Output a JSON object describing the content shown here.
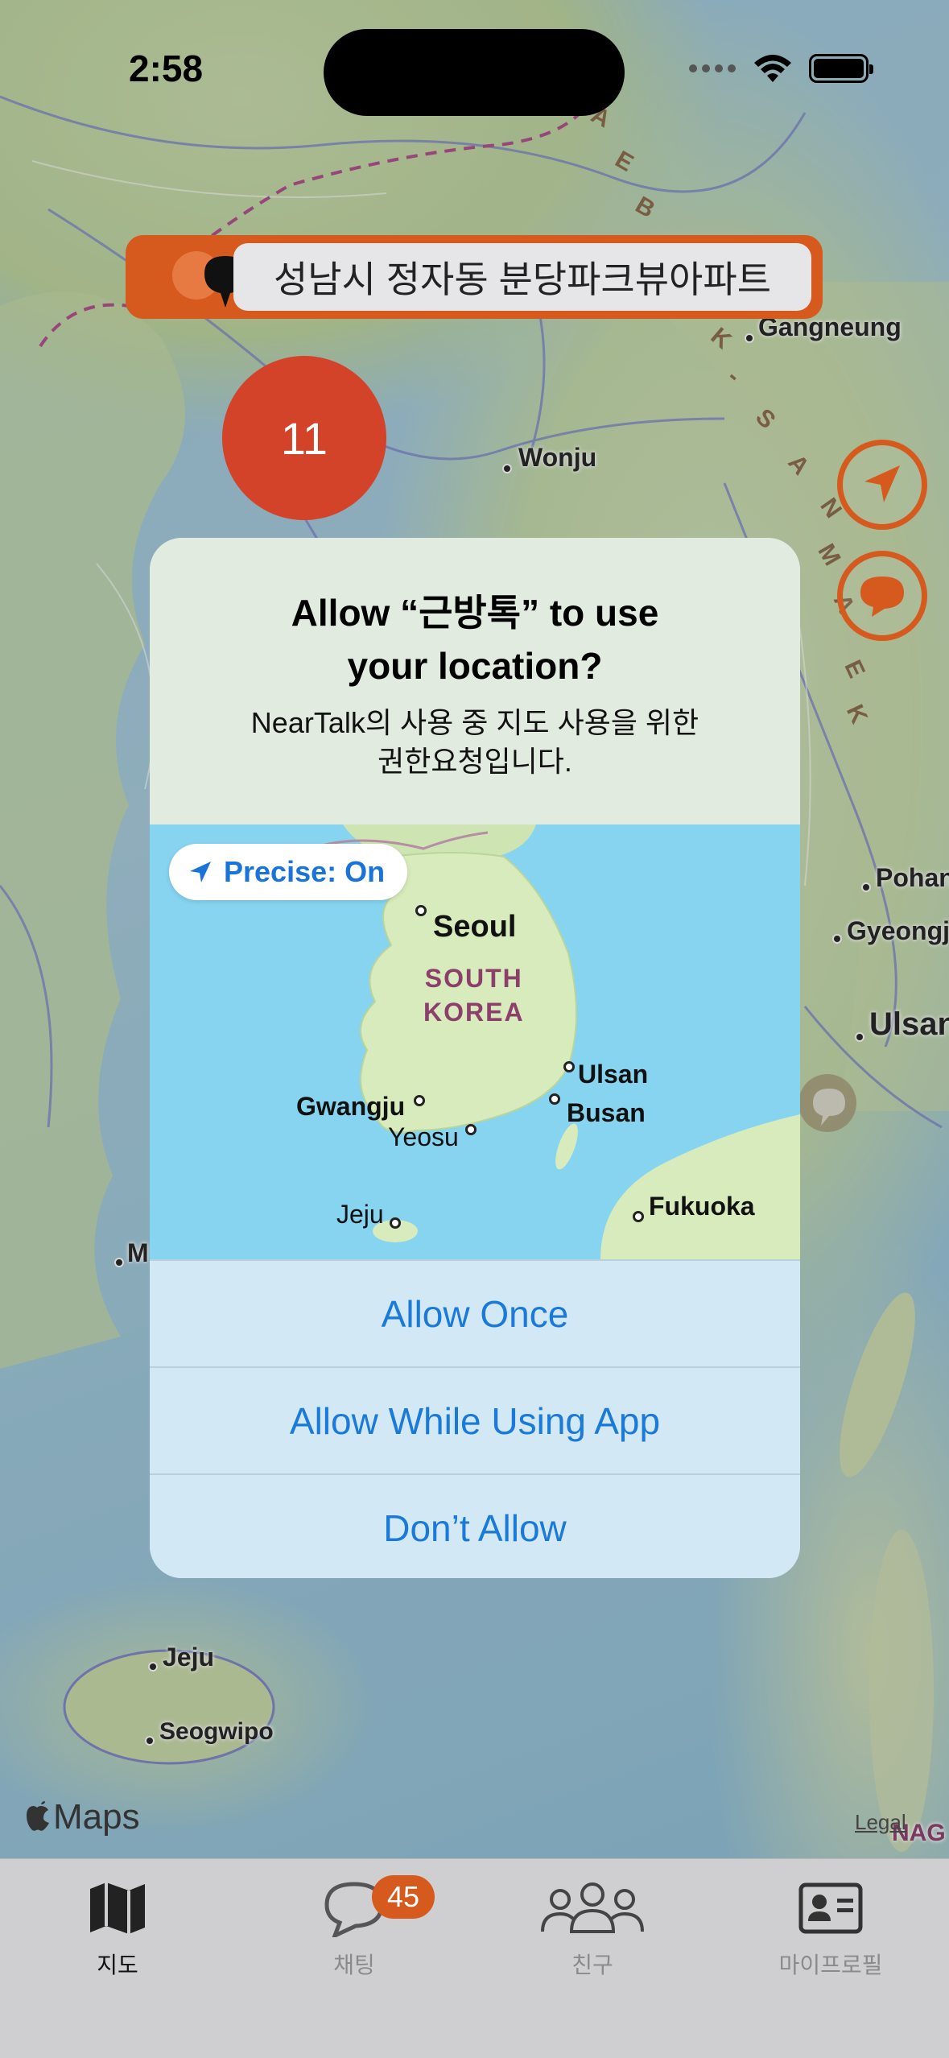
{
  "status_bar": {
    "time": "2:58"
  },
  "map": {
    "labels": {
      "gangneung": "Gangneung",
      "wonju": "Wonju",
      "pohang": "Pohan",
      "gyeongju": "Gyeongj",
      "ulsan": "Ulsan",
      "mokpo": "M",
      "jeju": "Jeju",
      "seogwipo": "Seogwipo",
      "nag": "NAG"
    },
    "sea_letters": [
      "A",
      "E",
      "B",
      "K",
      "-",
      "S",
      "A",
      "N",
      "M",
      "A",
      "E",
      "K"
    ]
  },
  "address_bar": {
    "text": "성남시 정자동 분당파크뷰아파트"
  },
  "cluster": {
    "count": "11"
  },
  "alert": {
    "title": "Allow “근방톡” to use your location?",
    "message": "NearTalk의 사용 중 지도 사용을 위한 권한요청입니다.",
    "precise_label": "Precise: On",
    "map_labels": {
      "seoul": "Seoul",
      "country_line1": "SOUTH",
      "country_line2": "KOREA",
      "ulsan": "Ulsan",
      "gwangju": "Gwangju",
      "busan": "Busan",
      "yeosu": "Yeosu",
      "jeju": "Jeju",
      "fukuoka": "Fukuoka"
    },
    "buttons": {
      "allow_once": "Allow Once",
      "allow_while_using": "Allow While Using App",
      "dont_allow": "Don’t Allow"
    }
  },
  "maps_attribution": {
    "logo_text": "Maps",
    "legal": "Legal"
  },
  "tabbar": {
    "tabs": [
      {
        "label": "지도",
        "icon": "map-icon",
        "active": true
      },
      {
        "label": "채팅",
        "icon": "chat-bubble-icon",
        "active": false,
        "badge": "45"
      },
      {
        "label": "친구",
        "icon": "people-icon",
        "active": false
      },
      {
        "label": "마이프로필",
        "icon": "profile-card-icon",
        "active": false
      }
    ]
  },
  "colors": {
    "accent": "#d65a1e",
    "cluster": "#d2432a",
    "alert_button_text": "#1a7ad9"
  }
}
